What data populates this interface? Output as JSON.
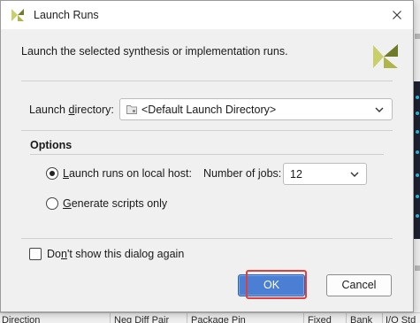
{
  "dialog": {
    "title": "Launch Runs",
    "description": "Launch the selected synthesis or implementation runs."
  },
  "launch_directory": {
    "label_pre": "Launch ",
    "label_mnemonic": "d",
    "label_post": "irectory:",
    "value": "<Default Launch Directory>"
  },
  "options": {
    "title": "Options",
    "local_host": {
      "label_mnemonic": "L",
      "label_post": "aunch runs on local host:",
      "selected": true
    },
    "jobs": {
      "label_pre": "Number of ",
      "label_mnemonic": "j",
      "label_post": "obs:",
      "value": "12"
    },
    "scripts_only": {
      "label_mnemonic": "G",
      "label_post": "enerate scripts only",
      "selected": false
    }
  },
  "dont_show": {
    "label_pre": "Do",
    "label_mnemonic": "n",
    "label_post": "'t show this dialog again",
    "checked": false
  },
  "buttons": {
    "ok": "OK",
    "cancel": "Cancel"
  },
  "background": {
    "left_fragments": [
      "th",
      "c",
      "-"
    ],
    "bottom_columns": [
      "Direction",
      "Neg Diff Pair",
      "Package Pin",
      "Fixed",
      "Bank",
      "I/O Std"
    ]
  },
  "colors": {
    "ok_button": "#4a7fd4",
    "highlight": "#d9403f",
    "logo_light": "#c9cf6a",
    "logo_dark": "#6f7a2a"
  }
}
